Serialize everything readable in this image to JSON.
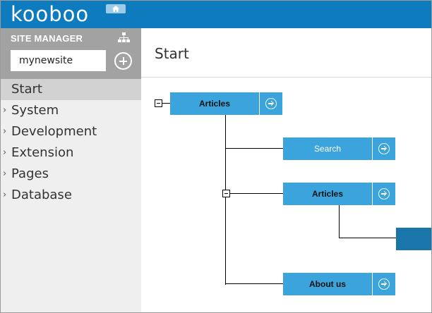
{
  "app": {
    "logo_text": "kooboo"
  },
  "sidebar": {
    "title": "SITE MANAGER",
    "site_input_value": "mynewsite",
    "items": [
      {
        "label": "Start",
        "active": true,
        "expandable": false
      },
      {
        "label": "System",
        "active": false,
        "expandable": true
      },
      {
        "label": "Development",
        "active": false,
        "expandable": true
      },
      {
        "label": "Extension",
        "active": false,
        "expandable": true
      },
      {
        "label": "Pages",
        "active": false,
        "expandable": true
      },
      {
        "label": "Database",
        "active": false,
        "expandable": true
      }
    ]
  },
  "main": {
    "title": "Start",
    "tree": {
      "root": {
        "label": "Articles"
      },
      "children": [
        {
          "label": "Search"
        },
        {
          "label": "Articles"
        },
        {
          "label": "About us"
        }
      ]
    }
  },
  "colors": {
    "topbar": "#0d7bbd",
    "node": "#3ba4dc",
    "node_dark": "#1a76aa",
    "sidebar_header": "#a2a2a2",
    "sidebar_bg": "#efefef"
  },
  "icons": {
    "home": "home-icon",
    "sitemap": "sitemap-icon",
    "add": "plus-circle-icon",
    "go": "arrow-circle-right-icon",
    "toggle": "collapse-minus-icon",
    "expand": "chevron-right-icon"
  }
}
